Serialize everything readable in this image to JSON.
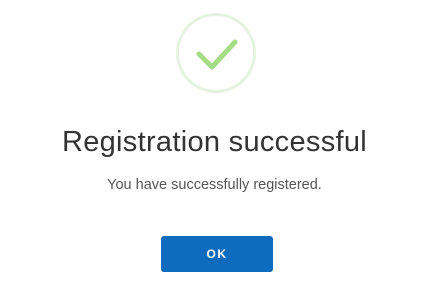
{
  "dialog": {
    "status_icon": "checkmark-icon",
    "title": "Registration successful",
    "message": "You have successfully registered.",
    "ok_label": "OK"
  },
  "colors": {
    "accent": "#0f6bbd",
    "success": "#a5dc86",
    "success_ring": "#e4f3df",
    "title_text": "#333333",
    "message_text": "#555555"
  }
}
